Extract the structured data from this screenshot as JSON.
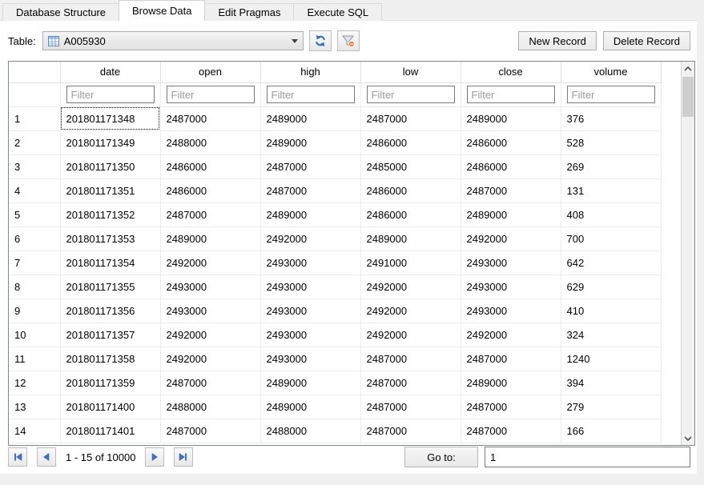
{
  "tabs": [
    {
      "label": "Database Structure",
      "active": false
    },
    {
      "label": "Browse Data",
      "active": true
    },
    {
      "label": "Edit Pragmas",
      "active": false
    },
    {
      "label": "Execute SQL",
      "active": false
    }
  ],
  "toolbar": {
    "table_label": "Table:",
    "table_selected": "A005930",
    "refresh_icon": "refresh-icon",
    "clear_filter_icon": "clear-all-filters-icon",
    "new_record_label": "New Record",
    "delete_record_label": "Delete Record"
  },
  "grid": {
    "columns": [
      "date",
      "open",
      "high",
      "low",
      "close",
      "volume"
    ],
    "filter_placeholder": "Filter",
    "rows": [
      {
        "num": "1",
        "date": "201801171348",
        "open": "2487000",
        "high": "2489000",
        "low": "2487000",
        "close": "2489000",
        "volume": "376"
      },
      {
        "num": "2",
        "date": "201801171349",
        "open": "2488000",
        "high": "2489000",
        "low": "2486000",
        "close": "2486000",
        "volume": "528"
      },
      {
        "num": "3",
        "date": "201801171350",
        "open": "2486000",
        "high": "2487000",
        "low": "2485000",
        "close": "2486000",
        "volume": "269"
      },
      {
        "num": "4",
        "date": "201801171351",
        "open": "2486000",
        "high": "2487000",
        "low": "2486000",
        "close": "2487000",
        "volume": "131"
      },
      {
        "num": "5",
        "date": "201801171352",
        "open": "2487000",
        "high": "2489000",
        "low": "2486000",
        "close": "2489000",
        "volume": "408"
      },
      {
        "num": "6",
        "date": "201801171353",
        "open": "2489000",
        "high": "2492000",
        "low": "2489000",
        "close": "2492000",
        "volume": "700"
      },
      {
        "num": "7",
        "date": "201801171354",
        "open": "2492000",
        "high": "2493000",
        "low": "2491000",
        "close": "2493000",
        "volume": "642"
      },
      {
        "num": "8",
        "date": "201801171355",
        "open": "2493000",
        "high": "2493000",
        "low": "2492000",
        "close": "2493000",
        "volume": "629"
      },
      {
        "num": "9",
        "date": "201801171356",
        "open": "2493000",
        "high": "2493000",
        "low": "2492000",
        "close": "2493000",
        "volume": "410"
      },
      {
        "num": "10",
        "date": "201801171357",
        "open": "2492000",
        "high": "2493000",
        "low": "2492000",
        "close": "2492000",
        "volume": "324"
      },
      {
        "num": "11",
        "date": "201801171358",
        "open": "2492000",
        "high": "2493000",
        "low": "2487000",
        "close": "2487000",
        "volume": "1240"
      },
      {
        "num": "12",
        "date": "201801171359",
        "open": "2487000",
        "high": "2489000",
        "low": "2487000",
        "close": "2489000",
        "volume": "394"
      },
      {
        "num": "13",
        "date": "201801171400",
        "open": "2488000",
        "high": "2489000",
        "low": "2487000",
        "close": "2487000",
        "volume": "279"
      },
      {
        "num": "14",
        "date": "201801171401",
        "open": "2487000",
        "high": "2488000",
        "low": "2487000",
        "close": "2487000",
        "volume": "166"
      }
    ]
  },
  "pagination": {
    "range_text": "1 - 15 of 10000",
    "goto_label": "Go to:",
    "goto_value": "1"
  },
  "colors": {
    "accent_blue": "#2a6ebb",
    "nav_arrow_blue": "#3f71c8",
    "filter_badge_orange": "#e8741e",
    "grid_line": "#ececec",
    "border_gray": "#82878f",
    "placeholder_gray": "#9b9b9b",
    "scroll_thumb": "#cdcdcd"
  }
}
